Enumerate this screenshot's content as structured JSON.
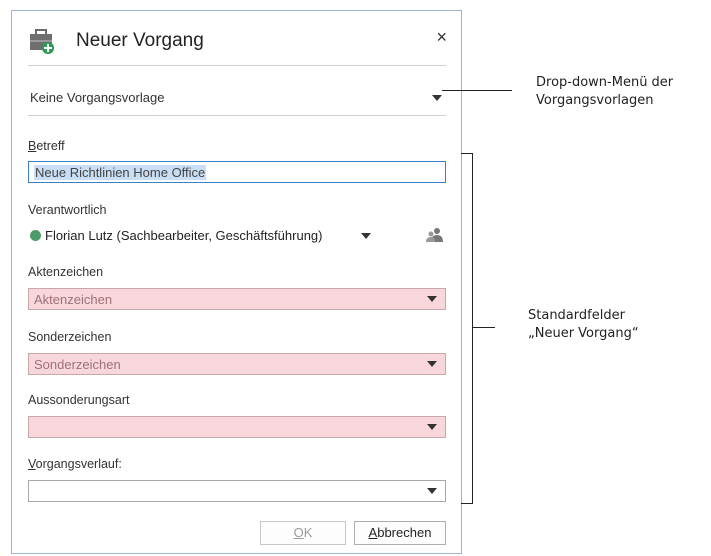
{
  "dialog": {
    "title": "Neuer Vorgang",
    "close_label": "×",
    "template": {
      "value": "Keine Vorgangsvorlage"
    },
    "fields": {
      "subject": {
        "label_prefix": "",
        "label_accesskey": "B",
        "label_rest": "etreff",
        "value": "Neue Richtlinien Home Office"
      },
      "responsible": {
        "label": "Verantwortlich",
        "value": "Florian Lutz (Sachbearbeiter, Geschäftsführung)"
      },
      "file_number": {
        "label": "Aktenzeichen",
        "placeholder": "Aktenzeichen"
      },
      "special_mark": {
        "label": "Sonderzeichen",
        "placeholder": "Sonderzeichen"
      },
      "disposal_type": {
        "label": "Aussonderungsart",
        "placeholder": ""
      },
      "history": {
        "label_accesskey": "V",
        "label_rest": "organgsverlauf:",
        "value": ""
      }
    },
    "buttons": {
      "ok": {
        "accesskey": "O",
        "rest": "K"
      },
      "cancel": {
        "accesskey": "A",
        "rest": "bbrechen"
      }
    }
  },
  "annotations": {
    "template_dropdown": [
      "Drop-down-Menü der",
      "Vorgangsvorlagen"
    ],
    "standard_fields": [
      "Standardfelder",
      "„Neuer Vorgang“"
    ]
  },
  "colors": {
    "required_field": "#f8d7dc",
    "focus_border": "#3c7fc7",
    "status_dot": "#4e9a6a"
  }
}
